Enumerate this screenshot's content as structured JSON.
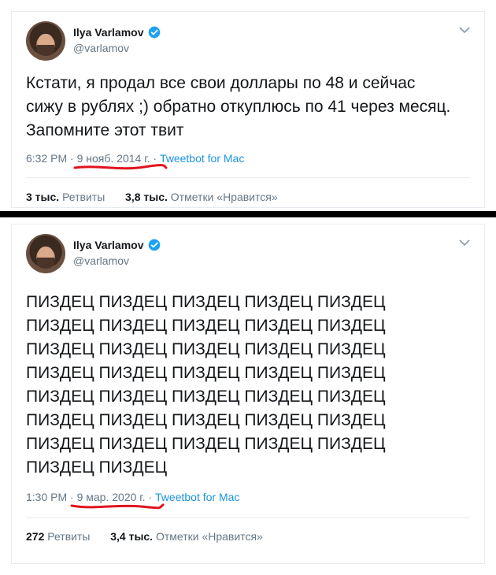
{
  "tweets": [
    {
      "author_name": "Ilya Varlamov",
      "author_handle": "@varlamov",
      "text": "Кстати, я продал все свои доллары по 48 и сейчас сижу в рублях ;) обратно откуплюсь по 41 через месяц. Запомните этот твит",
      "time": "6:32 PM",
      "sep1": " · ",
      "date": "9 нояб. 2014 г.",
      "sep2": " · ",
      "source": "Tweetbot for Mac",
      "retweets_count": "3 тыс.",
      "retweets_label": "Ретвиты",
      "likes_count": "3,8 тыс.",
      "likes_label": "Отметки «Нравится»",
      "icons": [
        "avatar",
        "verified-badge-icon",
        "chevron-down-icon"
      ]
    },
    {
      "author_name": "Ilya Varlamov",
      "author_handle": "@varlamov",
      "text": "ПИЗДЕЦ ПИЗДЕЦ ПИЗДЕЦ ПИЗДЕЦ ПИЗДЕЦ ПИЗДЕЦ ПИЗДЕЦ ПИЗДЕЦ ПИЗДЕЦ ПИЗДЕЦ ПИЗДЕЦ ПИЗДЕЦ ПИЗДЕЦ ПИЗДЕЦ ПИЗДЕЦ ПИЗДЕЦ ПИЗДЕЦ ПИЗДЕЦ ПИЗДЕЦ ПИЗДЕЦ ПИЗДЕЦ ПИЗДЕЦ ПИЗДЕЦ ПИЗДЕЦ ПИЗДЕЦ ПИЗДЕЦ ПИЗДЕЦ ПИЗДЕЦ ПИЗДЕЦ ПИЗДЕЦ ПИЗДЕЦ ПИЗДЕЦ ПИЗДЕЦ ПИЗДЕЦ ПИЗДЕЦ ПИЗДЕЦ ПИЗДЕЦ",
      "time": "1:30 PM",
      "sep1": " · ",
      "date": "9 мар. 2020 г.",
      "sep2": " · ",
      "source": "Tweetbot for Mac",
      "retweets_count": "272",
      "retweets_label": "Ретвиты",
      "likes_count": "3,4 тыс.",
      "likes_label": "Отметки «Нравится»",
      "icons": [
        "avatar",
        "verified-badge-icon",
        "chevron-down-icon"
      ]
    }
  ],
  "colors": {
    "verified": "#1da1f2",
    "link": "#1b95e0",
    "secondary_text": "#657786",
    "underline_annotation": "#e0141e"
  }
}
